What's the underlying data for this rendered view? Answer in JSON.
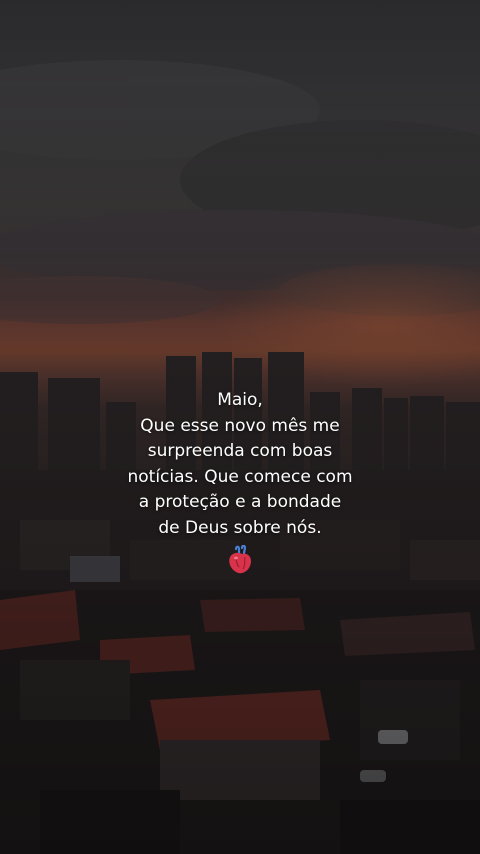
{
  "story": {
    "text_lines": [
      "Maio,",
      "Que esse novo mês me",
      "surpreenda com boas",
      "notícias. Que comece com",
      "a proteção e a bondade",
      "de Deus sobre nós."
    ],
    "emoji": "anatomical-heart-icon"
  },
  "colors": {
    "sky_top": "#2a2a2c",
    "sunset_glow": "#7a4634",
    "city_dark": "#1e1b1c",
    "roof_red": "#6a2f2a",
    "text": "#ffffff",
    "heart_red": "#d8334a"
  }
}
